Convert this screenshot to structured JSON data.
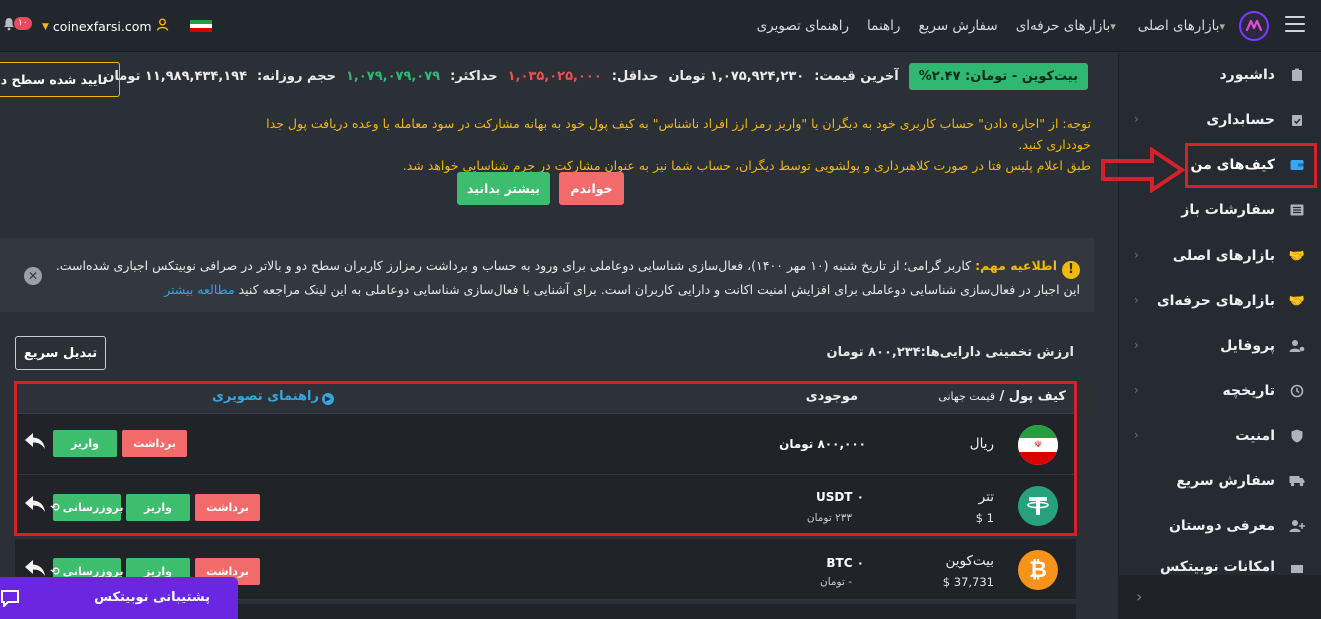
{
  "topbar": {
    "site": "coinexfarsi.com",
    "notification_count": "۱۰",
    "nav": [
      {
        "label": "بازارهای اصلی",
        "dropdown": true
      },
      {
        "label": "بازارهای حرفه‌ای",
        "dropdown": true
      },
      {
        "label": "سفارش سریع",
        "dropdown": false
      },
      {
        "label": "راهنما",
        "dropdown": false
      },
      {
        "label": "راهنمای تصویری",
        "dropdown": false
      }
    ]
  },
  "sidebar": {
    "items": [
      {
        "label": "داشبورد",
        "icon": "dashboard-icon",
        "chevron": false
      },
      {
        "label": "حسابداری",
        "icon": "clipboard-icon",
        "chevron": true
      },
      {
        "label": "کیف‌های من",
        "icon": "wallet-icon",
        "chevron": false,
        "active": true
      },
      {
        "label": "سفارشات باز",
        "icon": "list-icon",
        "chevron": false
      },
      {
        "label": "بازارهای اصلی",
        "icon": "handshake-icon",
        "chevron": true
      },
      {
        "label": "بازارهای حرفه‌ای",
        "icon": "handshake-icon",
        "chevron": true
      },
      {
        "label": "پروفایل",
        "icon": "user-gear-icon",
        "chevron": true
      },
      {
        "label": "تاریخچه",
        "icon": "history-icon",
        "chevron": true
      },
      {
        "label": "امنیت",
        "icon": "shield-icon",
        "chevron": true
      },
      {
        "label": "سفارش سریع",
        "icon": "truck-icon",
        "chevron": false
      },
      {
        "label": "معرفی دوستان",
        "icon": "user-plus-icon",
        "chevron": false
      },
      {
        "label": "امکانات نوبیتکس",
        "icon": "gift-icon",
        "chevron": false
      }
    ]
  },
  "ticker": {
    "pill": "بیت‌کوین - تومان: ۲.۴۷%",
    "last_price_label": "آخرین قیمت:",
    "last_price": "۱,۰۷۵,۹۲۴,۲۳۰ تومان",
    "min_label": "حداقل:",
    "min_value": "۱,۰۳۵,۰۲۵,۰۰۰",
    "max_label": "حداکثر:",
    "max_value": "۱,۰۷۹,۰۷۹,۰۷۹",
    "volume_label": "حجم روزانه:",
    "volume_value": "۱۱,۹۸۹,۴۳۴,۱۹۴ تومان",
    "verify_button": "تایید شده سطح دو"
  },
  "warning": {
    "line1": "توجه: از \"اجاره دادن\" حساب کاربری خود به دیگران یا \"واریز رمز ارز افراد ناشناس\" به کیف پول خود به بهانه مشارکت در سود معامله یا وعده دریافت پول جدا خودداری کنید.",
    "line2": "طبق اعلام پلیس فتا در صورت کلاهبرداری و پولشویی توسط دیگران، حساب شما نیز به عنوان مشارکت در جرم شناسایی خواهد شد.",
    "read_button": "خواندم",
    "more_button": "بیشتر بدانید"
  },
  "notice": {
    "title": "اطلاعیه مهم:",
    "body": "کاربر گرامی؛ از تاریخ شنبه (۱۰ مهر ۱۴۰۰)، فعال‌سازی شناسایی دوعاملی برای ورود به حساب و برداشت رمزارز کاربران سطح دو و بالاتر در صرافی نوبیتکس اجباری شده‌است. این اجبار در فعال‌سازی شناسایی دوعاملی برای افزایش امنیت اکانت و دارایی کاربران است. برای آشنایی با فعال‌سازی شناسایی دوعاملی به این لینک مراجعه کنید",
    "link": "مطالعه بیشتر"
  },
  "estimate": {
    "text": "ارزش تخمینی دارایی‌ها:۸۰۰,۲۳۴ تومان",
    "quick_convert": "تبدیل سریع"
  },
  "table": {
    "col_wallet": "کیف پول /",
    "col_wallet_sub": "قیمت جهانی",
    "col_balance": "موجودی",
    "col_guide": "راهنمای تصویری",
    "rows": [
      {
        "name": "ریال",
        "price": "",
        "balance": "۸۰۰,۰۰۰ تومان",
        "balance_sub": "",
        "withdraw": "برداشت",
        "deposit": "واریز",
        "update": ""
      },
      {
        "name": "تتر",
        "price": "$  1",
        "balance": "USDT ۰",
        "balance_sub": "۲۳۳ تومان",
        "withdraw": "برداشت",
        "deposit": "واریز",
        "update": "بروزرسانی"
      },
      {
        "name": "بیت‌کوین",
        "price": "$  37,731",
        "balance": "BTC ۰",
        "balance_sub": "- تومان",
        "withdraw": "برداشت",
        "deposit": "واریز",
        "update": "بروزرسانی"
      }
    ]
  },
  "support": {
    "label": "پشتیبانی نوبیتکس"
  },
  "colors": {
    "accent_green": "#3dbd6e",
    "accent_red": "#f26b6b",
    "warning_yellow": "#f0b90b",
    "highlight_red": "#d8202a",
    "support_purple": "#6a26e0"
  }
}
